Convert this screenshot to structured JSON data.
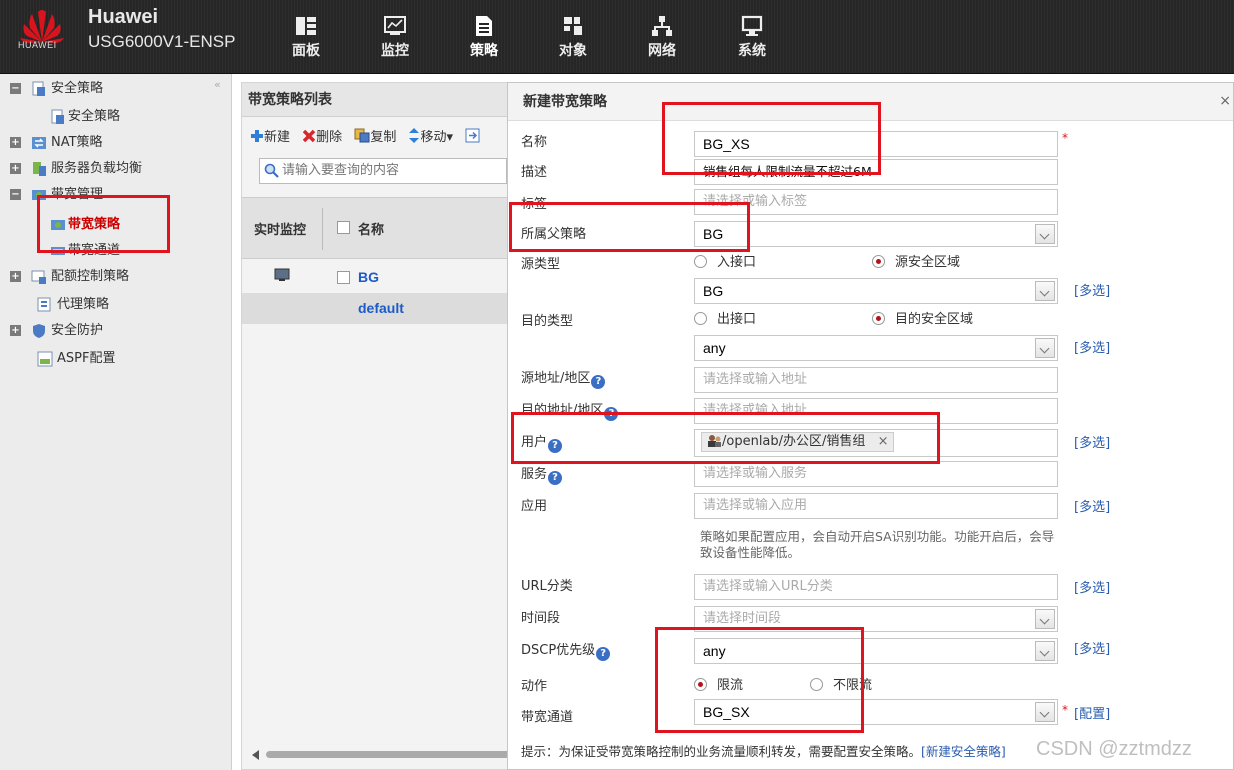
{
  "header": {
    "logo_text": "HUAWEI",
    "brand_line1": "Huawei",
    "brand_line2": "USG6000V1-ENSP",
    "tabs": [
      {
        "label": "面板",
        "icon": "dashboard-icon"
      },
      {
        "label": "监控",
        "icon": "monitor-icon"
      },
      {
        "label": "策略",
        "icon": "policy-icon",
        "active": true
      },
      {
        "label": "对象",
        "icon": "object-icon"
      },
      {
        "label": "网络",
        "icon": "network-icon"
      },
      {
        "label": "系统",
        "icon": "system-icon"
      }
    ]
  },
  "sidebar": {
    "collapse_glyph": "«",
    "items": [
      {
        "label": "安全策略",
        "expander": "−"
      },
      {
        "label": "安全策略"
      },
      {
        "label": "NAT策略",
        "expander": "+"
      },
      {
        "label": "服务器负载均衡",
        "expander": "+"
      },
      {
        "label": "带宽管理",
        "expander": "−"
      },
      {
        "label": "带宽策略",
        "selected": true
      },
      {
        "label": "带宽通道"
      },
      {
        "label": "配额控制策略",
        "expander": "+"
      },
      {
        "label": "代理策略"
      },
      {
        "label": "安全防护",
        "expander": "+"
      },
      {
        "label": "ASPF配置"
      }
    ]
  },
  "list": {
    "title": "带宽策略列表",
    "toolbar": {
      "new": "新建",
      "delete": "删除",
      "copy": "复制",
      "move": "移动▾"
    },
    "search_placeholder": "请输入要查询的内容",
    "columns": {
      "monitor": "实时监控",
      "name": "名称"
    },
    "rows": [
      {
        "name": "BG"
      },
      {
        "name": "default"
      }
    ]
  },
  "dialog": {
    "title": "新建带宽策略",
    "close_glyph": "×",
    "name_label": "名称",
    "name_value": "BG_XS",
    "desc_label": "描述",
    "desc_value": "销售组每人限制流量不超过6M",
    "tag_label": "标签",
    "tag_placeholder": "请选择或输入标签",
    "parent_label": "所属父策略",
    "parent_value": "BG",
    "src_type_label": "源类型",
    "src_type_opt1": "入接口",
    "src_type_opt2": "源安全区域",
    "src_zone_value": "BG",
    "dst_type_label": "目的类型",
    "dst_type_opt1": "出接口",
    "dst_type_opt2": "目的安全区域",
    "dst_zone_value": "any",
    "src_addr_label": "源地址/地区",
    "src_addr_placeholder": "请选择或输入地址",
    "dst_addr_label": "目的地址/地区",
    "dst_addr_placeholder": "请选择或输入地址",
    "user_label": "用户",
    "user_tag": "/openlab/办公区/销售组",
    "user_tag_remove": "×",
    "service_label": "服务",
    "service_placeholder": "请选择或输入服务",
    "app_label": "应用",
    "app_placeholder": "请选择或输入应用",
    "app_note": "策略如果配置应用，会自动开启SA识别功能。功能开启后，会导致设备性能降低。",
    "url_label": "URL分类",
    "url_placeholder": "请选择或输入URL分类",
    "time_label": "时间段",
    "time_placeholder": "请选择时间段",
    "dscp_label": "DSCP优先级",
    "dscp_value": "any",
    "action_label": "动作",
    "action_opt1": "限流",
    "action_opt2": "不限流",
    "channel_label": "带宽通道",
    "channel_value": "BG_SX",
    "multi_select": "[多选]",
    "config_link": "[配置]",
    "required_mark": "*",
    "help_glyph": "?",
    "footer_hint": "提示：为保证受带宽策略控制的业务流量顺利转发，需要配置安全策略。",
    "footer_link": "[新建安全策略]"
  },
  "watermark": "CSDN @zztmdzz",
  "colors": {
    "accent_red": "#e0141e",
    "link_blue": "#2a5db0",
    "topbar": "#262626"
  }
}
